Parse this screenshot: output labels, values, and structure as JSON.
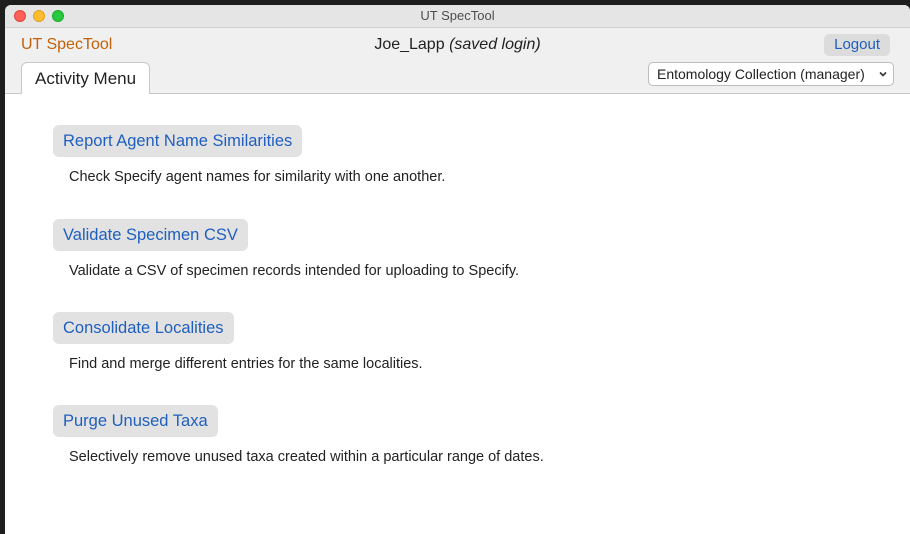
{
  "window": {
    "title": "UT SpecTool"
  },
  "header": {
    "app_name": "UT SpecTool",
    "user_name": "Joe_Lapp",
    "login_status": "(saved login)",
    "logout_label": "Logout"
  },
  "tabs": [
    {
      "label": "Activity Menu",
      "active": true
    }
  ],
  "collection_select": {
    "selected": "Entomology Collection (manager)",
    "icon": "chevron-down-icon"
  },
  "activities": [
    {
      "button": "Report Agent Name Similarities",
      "description": "Check Specify agent names for similarity with one another."
    },
    {
      "button": "Validate Specimen CSV",
      "description": "Validate a CSV of specimen records intended for uploading to Specify."
    },
    {
      "button": "Consolidate Localities",
      "description": "Find and merge different entries for the same localities."
    },
    {
      "button": "Purge Unused Taxa",
      "description": "Selectively remove unused taxa created within a particular range of dates."
    }
  ],
  "colors": {
    "app_name": "#c2620a",
    "link": "#1f5fbf",
    "button_bg": "#e2e2e2"
  }
}
